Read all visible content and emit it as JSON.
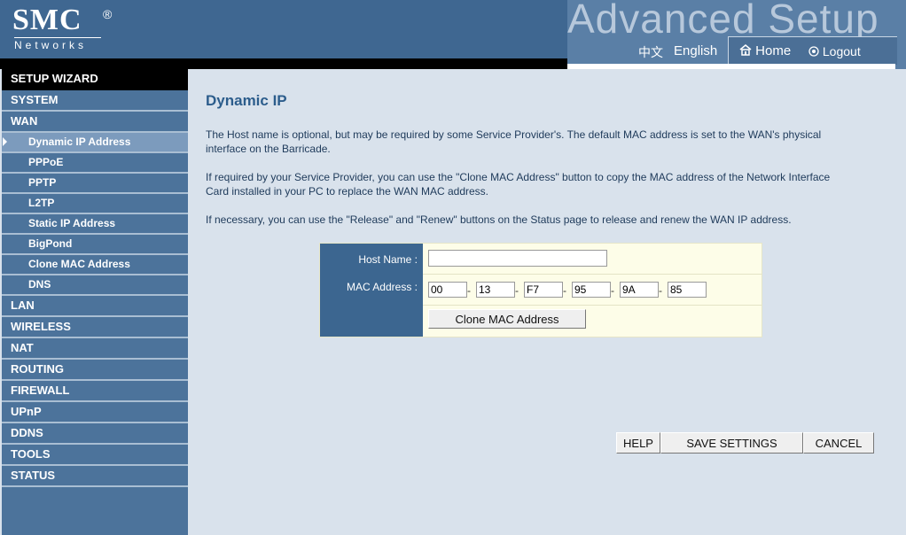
{
  "header": {
    "logo": "SMC",
    "logo_reg": "®",
    "logo_sub": "Networks",
    "title": "Advanced Setup",
    "lang_zh": "中文",
    "lang_en": "English",
    "home": "Home",
    "logout": "Logout"
  },
  "sidebar": {
    "wizard": "SETUP WIZARD",
    "system": "SYSTEM",
    "wan": "WAN",
    "wan_items": [
      "Dynamic IP Address",
      "PPPoE",
      "PPTP",
      "L2TP",
      "Static IP Address",
      "BigPond",
      "Clone MAC Address",
      "DNS"
    ],
    "sections": [
      "LAN",
      "WIRELESS",
      "NAT",
      "ROUTING",
      "FIREWALL",
      "UPnP",
      "DDNS",
      "TOOLS",
      "STATUS"
    ]
  },
  "main": {
    "title": "Dynamic IP",
    "paragraphs": [
      "The Host name is optional, but may be required by some Service Provider's. The default MAC address is set to the WAN's physical interface on the Barricade.",
      "If required by your Service Provider, you can use the \"Clone MAC Address\" button to copy the MAC address of the Network Interface Card installed in your PC to replace the WAN MAC address.",
      "If necessary, you can use the \"Release\" and \"Renew\" buttons on the Status page to release and renew the WAN IP address."
    ],
    "form": {
      "host_label": "Host Name :",
      "host_value": "",
      "mac_label": "MAC Address :",
      "mac": [
        "00",
        "13",
        "F7",
        "95",
        "9A",
        "85"
      ],
      "dash": "-",
      "clone_button": "Clone MAC Address"
    },
    "buttons": {
      "help": "HELP",
      "save": "SAVE SETTINGS",
      "cancel": "CANCEL"
    }
  }
}
